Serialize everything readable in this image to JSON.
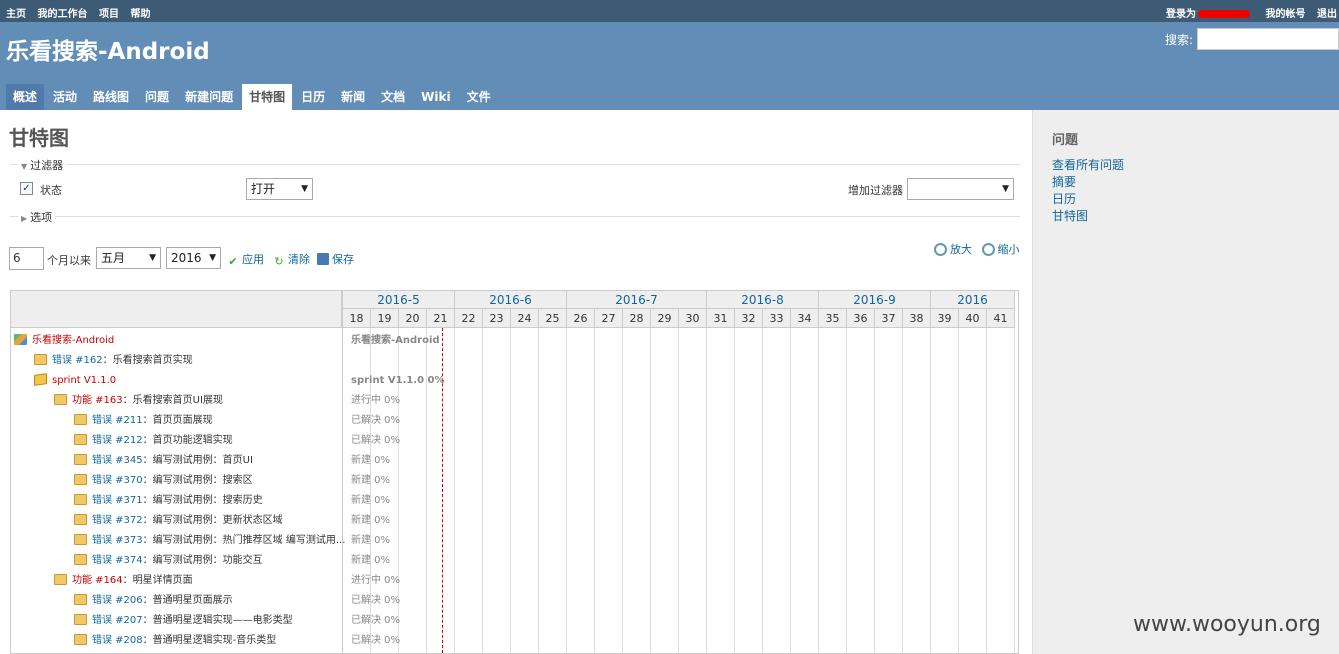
{
  "top_menu": {
    "left": [
      "主页",
      "我的工作台",
      "项目",
      "帮助"
    ],
    "logged_in_as": "登录为",
    "my_account": "我的帐号",
    "logout": "退出"
  },
  "header": {
    "title": "乐看搜索-Android",
    "search_label": "搜索:"
  },
  "tabs": [
    "概述",
    "活动",
    "路线图",
    "问题",
    "新建问题",
    "甘特图",
    "日历",
    "新闻",
    "文档",
    "Wiki",
    "文件"
  ],
  "selected_tab": "甘特图",
  "page_title": "甘特图",
  "filters": {
    "legend": "过滤器",
    "status_label": "状态",
    "status_value": "打开",
    "add_filter_label": "增加过滤器",
    "add_filter_value": ""
  },
  "options_legend": "选项",
  "controls": {
    "months": "6",
    "months_label": "个月以来",
    "month": "五月",
    "year": "2016",
    "apply": "应用",
    "clear": "清除",
    "save": "保存",
    "zoom_in": "放大",
    "zoom_out": "缩小"
  },
  "gantt": {
    "months": [
      {
        "label": "2016-5",
        "weeks": 4
      },
      {
        "label": "2016-6",
        "weeks": 4
      },
      {
        "label": "2016-7",
        "weeks": 5
      },
      {
        "label": "2016-8",
        "weeks": 4
      },
      {
        "label": "2016-9",
        "weeks": 4
      },
      {
        "label": "2016",
        "weeks": 3
      }
    ],
    "weeks": [
      "18",
      "19",
      "20",
      "21",
      "22",
      "23",
      "24",
      "25",
      "26",
      "27",
      "28",
      "29",
      "30",
      "31",
      "32",
      "33",
      "34",
      "35",
      "36",
      "37",
      "38",
      "39",
      "40",
      "41"
    ],
    "rows": [
      {
        "kind": "project",
        "indent": 0,
        "tracker": "",
        "subject": "乐看搜索-Android",
        "label": "乐看搜索-Android",
        "bold": true
      },
      {
        "kind": "issue",
        "indent": 1,
        "tracker": "错误 #162",
        "subject": "乐看搜索首页实现",
        "label": "",
        "bold": false
      },
      {
        "kind": "version",
        "indent": 1,
        "tracker": "",
        "subject": "sprint V1.1.0",
        "label": "sprint V1.1.0 0%",
        "bold": true
      },
      {
        "kind": "feature",
        "indent": 2,
        "tracker": "功能 #163",
        "subject": "乐看搜索首页UI展现",
        "label": "进行中 0%",
        "bold": false
      },
      {
        "kind": "issue",
        "indent": 3,
        "tracker": "错误 #211",
        "subject": "首页页面展现",
        "label": "已解决 0%",
        "bold": false
      },
      {
        "kind": "issue",
        "indent": 3,
        "tracker": "错误 #212",
        "subject": "首页功能逻辑实现",
        "label": "已解决 0%",
        "bold": false
      },
      {
        "kind": "issue",
        "indent": 3,
        "tracker": "错误 #345",
        "subject": "编写测试用例：首页UI",
        "label": "新建 0%",
        "bold": false
      },
      {
        "kind": "issue",
        "indent": 3,
        "tracker": "错误 #370",
        "subject": "编写测试用例：搜索区",
        "label": "新建 0%",
        "bold": false
      },
      {
        "kind": "issue",
        "indent": 3,
        "tracker": "错误 #371",
        "subject": "编写测试用例：搜索历史",
        "label": "新建 0%",
        "bold": false
      },
      {
        "kind": "issue",
        "indent": 3,
        "tracker": "错误 #372",
        "subject": "编写测试用例：更新状态区域",
        "label": "新建 0%",
        "bold": false
      },
      {
        "kind": "issue",
        "indent": 3,
        "tracker": "错误 #373",
        "subject": "编写测试用例：热门推荐区域 编写测试用...",
        "label": "新建 0%",
        "bold": false
      },
      {
        "kind": "issue",
        "indent": 3,
        "tracker": "错误 #374",
        "subject": "编写测试用例：功能交互",
        "label": "新建 0%",
        "bold": false
      },
      {
        "kind": "feature",
        "indent": 2,
        "tracker": "功能 #164",
        "subject": "明星详情页面",
        "label": "进行中 0%",
        "bold": false
      },
      {
        "kind": "issue",
        "indent": 3,
        "tracker": "错误 #206",
        "subject": "普通明星页面展示",
        "label": "已解决 0%",
        "bold": false
      },
      {
        "kind": "issue",
        "indent": 3,
        "tracker": "错误 #207",
        "subject": "普通明星逻辑实现——电影类型",
        "label": "已解决 0%",
        "bold": false
      },
      {
        "kind": "issue",
        "indent": 3,
        "tracker": "错误 #208",
        "subject": "普通明星逻辑实现-音乐类型",
        "label": "已解决 0%",
        "bold": false
      }
    ]
  },
  "sidebar": {
    "title": "问题",
    "links": [
      "查看所有问题",
      "摘要",
      "日历",
      "甘特图"
    ]
  },
  "watermark": "www.wooyun.org"
}
